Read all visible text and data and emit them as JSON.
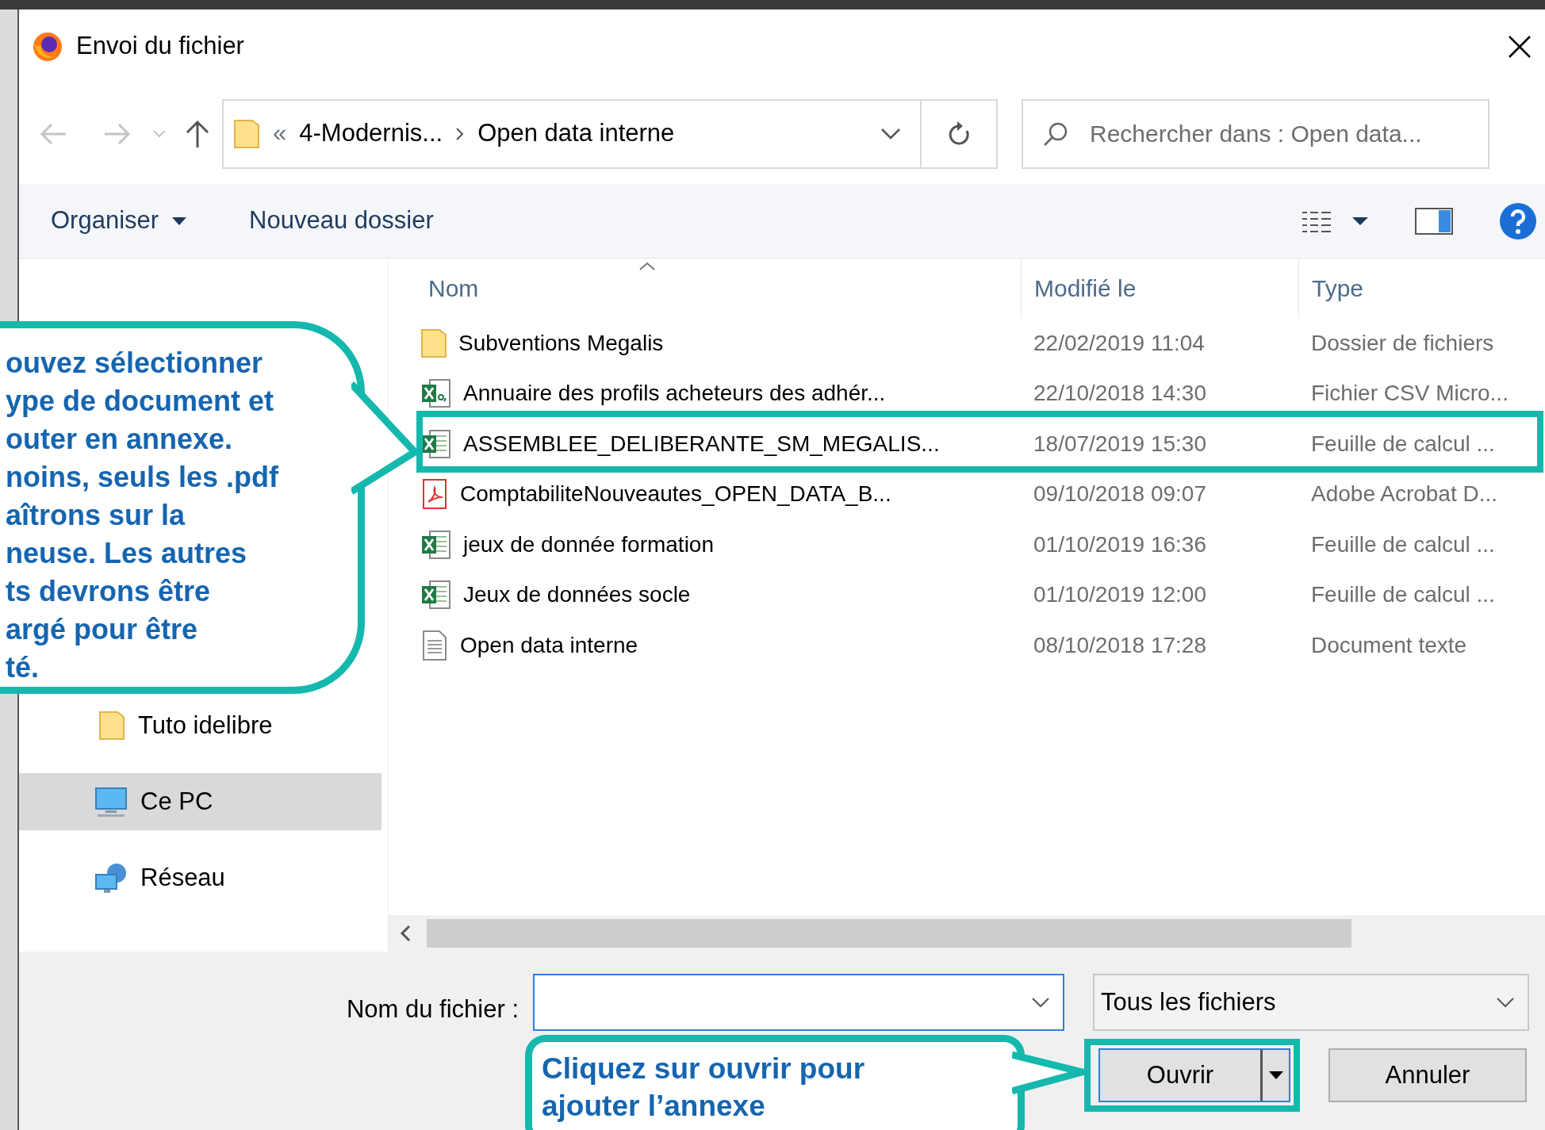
{
  "window": {
    "title": "Envoi du fichier"
  },
  "address_bar": {
    "overflow": "«",
    "segments": [
      "4-Modernis...",
      "Open data interne"
    ]
  },
  "search": {
    "placeholder": "Rechercher dans : Open data..."
  },
  "toolbar": {
    "buttons": [
      {
        "label": "Organiser",
        "dropdown": true
      },
      {
        "label": "Nouveau dossier",
        "dropdown": false
      }
    ]
  },
  "sidebar": {
    "items": [
      {
        "label": "Tuto idelibre",
        "kind": "folder",
        "selected": false
      },
      {
        "label": "Ce PC",
        "kind": "pc",
        "selected": true
      },
      {
        "label": "Réseau",
        "kind": "network",
        "selected": false
      }
    ]
  },
  "file_list": {
    "columns": [
      "Nom",
      "Modifié le",
      "Type"
    ],
    "rows": [
      {
        "name": "Subventions Megalis",
        "modified": "22/02/2019 11:04",
        "type": "Dossier de fichiers",
        "kind": "folder",
        "highlighted": false
      },
      {
        "name": "Annuaire des profils acheteurs des adhér...",
        "modified": "22/10/2018 14:30",
        "type": "Fichier CSV Micro...",
        "kind": "csv",
        "highlighted": false
      },
      {
        "name": "ASSEMBLEE_DELIBERANTE_SM_MEGALIS...",
        "modified": "18/07/2019 15:30",
        "type": "Feuille de calcul ...",
        "kind": "excel",
        "highlighted": true
      },
      {
        "name": "ComptabiliteNouveautes_OPEN_DATA_B...",
        "modified": "09/10/2018 09:07",
        "type": "Adobe Acrobat D...",
        "kind": "pdf",
        "highlighted": false
      },
      {
        "name": "jeux de donnée formation",
        "modified": "01/10/2019 16:36",
        "type": "Feuille de calcul ...",
        "kind": "excel",
        "highlighted": false
      },
      {
        "name": "Jeux de données socle",
        "modified": "01/10/2019 12:00",
        "type": "Feuille de calcul ...",
        "kind": "excel",
        "highlighted": false
      },
      {
        "name": "Open data interne",
        "modified": "08/10/2018 17:28",
        "type": "Document texte",
        "kind": "text",
        "highlighted": false
      }
    ]
  },
  "file_name": {
    "label": "Nom du fichier :"
  },
  "file_type": {
    "value": "Tous les fichiers"
  },
  "buttons": [
    {
      "label": "Ouvrir",
      "kind": "split",
      "highlighted": true
    },
    {
      "label": "Annuler",
      "kind": "plain",
      "highlighted": false
    }
  ],
  "callouts": [
    {
      "text": "ouvez sélectionner\nype de document et\nouter en annexe.\nnoins, seuls les .pdf\naîtrons sur la\nneuse. Les autres\nts devrons être\nargé pour être\nté."
    },
    {
      "text": "Cliquez sur ouvrir pour\najouter l’annexe"
    }
  ]
}
